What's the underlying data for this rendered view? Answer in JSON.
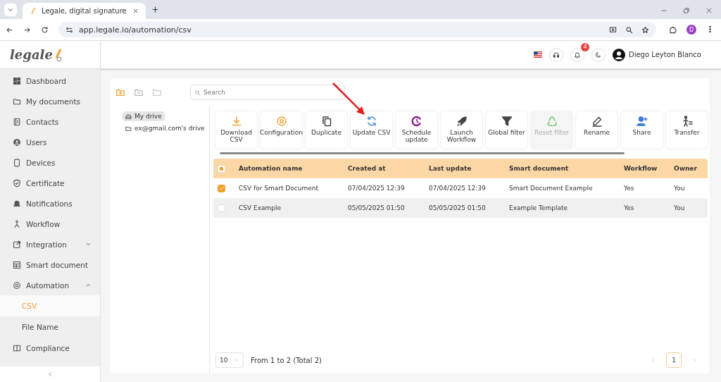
{
  "browser": {
    "tab_title": "Legale, digital signature",
    "url": "app.legale.io/automation/csv",
    "profile_initial": "D"
  },
  "logo": "legale",
  "header": {
    "notification_count": "4",
    "user_name": "Diego Leyton Blanco"
  },
  "sidebar": {
    "items": [
      {
        "label": "Dashboard",
        "selected": false
      },
      {
        "label": "My documents",
        "selected": false
      },
      {
        "label": "Contacts",
        "selected": false
      },
      {
        "label": "Users",
        "selected": false
      },
      {
        "label": "Devices",
        "selected": false
      },
      {
        "label": "Certificate",
        "selected": false
      },
      {
        "label": "Notifications",
        "selected": false
      },
      {
        "label": "Workflow",
        "selected": false
      },
      {
        "label": "Integration",
        "selected": false,
        "expanded": false
      },
      {
        "label": "Smart document",
        "selected": false
      },
      {
        "label": "Automation",
        "selected": false,
        "expanded": true,
        "children": [
          {
            "label": "CSV",
            "selected": true
          },
          {
            "label": "File Name",
            "selected": false
          }
        ]
      },
      {
        "label": "Compliance",
        "selected": false
      }
    ]
  },
  "search": {
    "placeholder": "Search"
  },
  "tree": [
    {
      "label": "My drive",
      "selected": true
    },
    {
      "label": "ex@gmail.com's drive",
      "selected": false
    }
  ],
  "toolbar": [
    {
      "label": "Download CSV",
      "disabled": false
    },
    {
      "label": "Configuration",
      "disabled": false
    },
    {
      "label": "Duplicate",
      "disabled": false
    },
    {
      "label": "Update CSV",
      "disabled": false
    },
    {
      "label": "Schedule update",
      "disabled": false
    },
    {
      "label": "Launch Workflow",
      "disabled": false
    },
    {
      "label": "Global filter",
      "disabled": false
    },
    {
      "label": "Reset filter",
      "disabled": true
    },
    {
      "label": "Rename",
      "disabled": false
    },
    {
      "label": "Share",
      "disabled": false
    },
    {
      "label": "Transfer",
      "disabled": false
    }
  ],
  "table": {
    "select_all_partial": true,
    "columns": [
      "Automation name",
      "Created at",
      "Last update",
      "Smart document",
      "Workflow",
      "Owner"
    ],
    "rows": [
      {
        "selected": true,
        "cells": [
          "CSV for Smart Document",
          "07/04/2025 12:39",
          "07/04/2025 12:39",
          "Smart Document Example",
          "Yes",
          "You"
        ]
      },
      {
        "selected": false,
        "cells": [
          "CSV Example",
          "05/05/2025 01:50",
          "05/05/2025 01:50",
          "Example Template",
          "Yes",
          "You"
        ]
      }
    ]
  },
  "pagination": {
    "page_size": "10",
    "summary": "From 1 to 2 (Total 2)",
    "pages": [
      {
        "label": "1",
        "selected": true
      }
    ]
  }
}
